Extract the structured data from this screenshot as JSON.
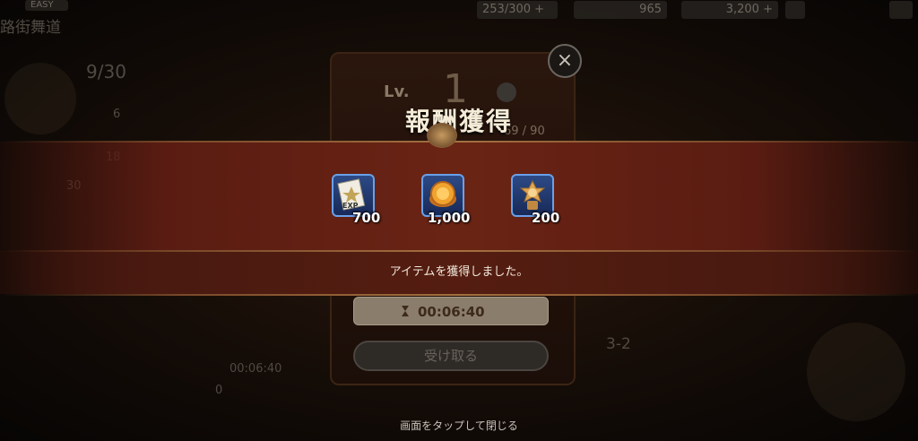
{
  "dialog": {
    "title": "報酬獲得",
    "message": "アイテムを獲得しました。",
    "close_icon": "close-icon",
    "tap_hint": "画面をタップして閉じる"
  },
  "rewards": [
    {
      "icon": "exp-scroll-icon",
      "quantity": "700"
    },
    {
      "icon": "gold-coin-icon",
      "quantity": "1,000"
    },
    {
      "icon": "medal-icon",
      "quantity": "200"
    }
  ],
  "under_panel": {
    "level_label": "Lv.",
    "level_value": "1",
    "exp_progress": "69 / 90",
    "timer": "00:06:40",
    "receive_label": "受け取る"
  },
  "hud": {
    "difficulty": "EASY",
    "stage_title": "路街舞道",
    "stamina": "253/300",
    "stamina_plus": "+",
    "gems": "965",
    "gold": "3,200",
    "gold_plus": "+",
    "progress": "9/30",
    "stars_6": "6",
    "stars_18": "18",
    "stars_30": "30",
    "stage_number": "3-2",
    "left_timer": "00:06:40",
    "left_count": "0"
  },
  "colors": {
    "banner_red": "#6a2414",
    "item_frame_blue": "#6aa0e8",
    "gold_accent": "#a47040"
  }
}
